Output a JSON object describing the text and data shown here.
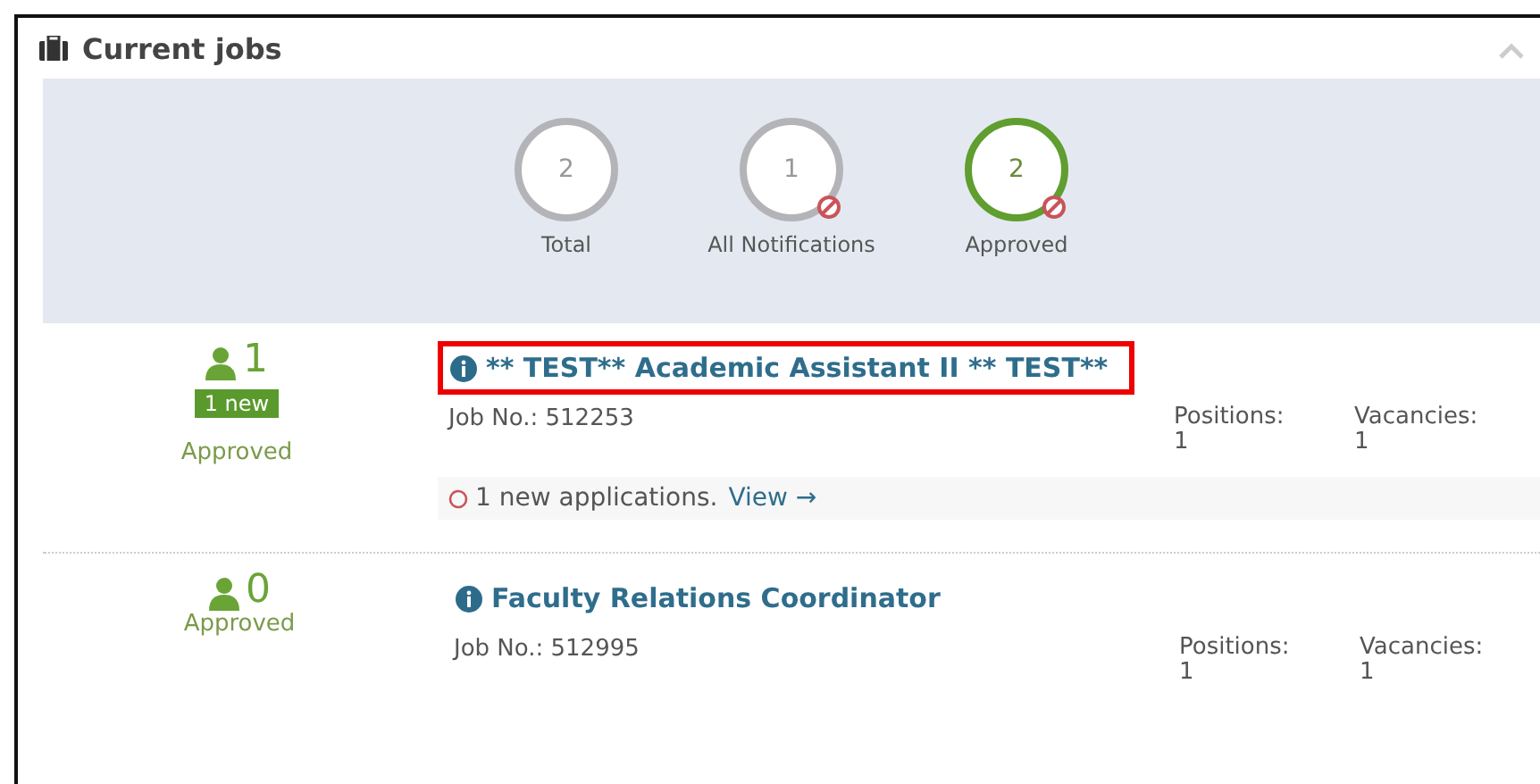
{
  "panel": {
    "title": "Current jobs",
    "collapsed": false
  },
  "stats": [
    {
      "value": "2",
      "label": "Total",
      "color": "#b4b4b8",
      "flagged": false
    },
    {
      "value": "1",
      "label": "All Notifications",
      "color": "#b4b4b8",
      "flagged": true
    },
    {
      "value": "2",
      "label": "Approved",
      "color": "#5f9e2f",
      "flagged": true
    }
  ],
  "jobs": [
    {
      "count": "1",
      "new_badge": "1 new",
      "status": "Approved",
      "title": "** TEST** Academic Assistant II ** TEST**",
      "highlighted": true,
      "job_no": "Job No.: 512253",
      "positions_label": "Positions:",
      "positions": "1",
      "vacancies_label": "Vacancies:",
      "vacancies": "1",
      "notice": "1 new applications.",
      "notice_link": "View →"
    },
    {
      "count": "0",
      "status": "Approved",
      "title": "Faculty Relations Coordinator",
      "highlighted": false,
      "job_no": "Job No.: 512995",
      "positions_label": "Positions:",
      "positions": "1",
      "vacancies_label": "Vacancies:",
      "vacancies": "1"
    }
  ]
}
